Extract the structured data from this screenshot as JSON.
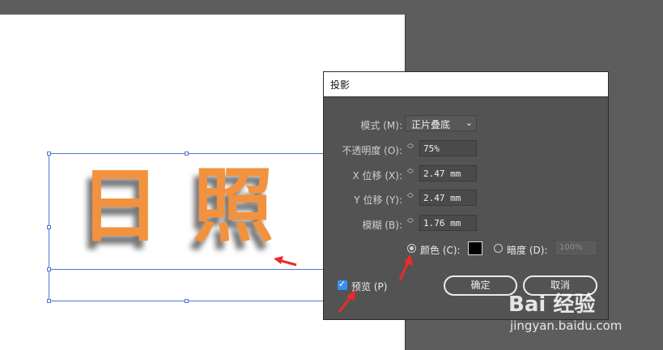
{
  "canvas": {
    "text": "日照",
    "text_color": "#f2923f",
    "selection_color": "#4a78d6"
  },
  "dialog": {
    "title": "投影",
    "mode_label": "模式 (M):",
    "mode_value": "正片叠底",
    "opacity_label": "不透明度 (O):",
    "opacity_value": "75%",
    "x_offset_label": "X 位移 (X):",
    "x_offset_value": "2.47 mm",
    "y_offset_label": "Y 位移 (Y):",
    "y_offset_value": "2.47 mm",
    "blur_label": "模糊 (B):",
    "blur_value": "1.76 mm",
    "color_label": "颜色 (C):",
    "color_selected": true,
    "shadow_color": "#000000",
    "darkness_label": "暗度 (D):",
    "darkness_value": "100%",
    "preview_label": "预览 (P)",
    "preview_checked": true,
    "ok_label": "确定",
    "cancel_label": "取消",
    "accent_color": "#3c8ef0"
  },
  "annotations": {
    "arrow_color": "#ee2a2a"
  },
  "watermark": {
    "logo": "Bai 经验",
    "url": "jingyan.baidu.com"
  }
}
